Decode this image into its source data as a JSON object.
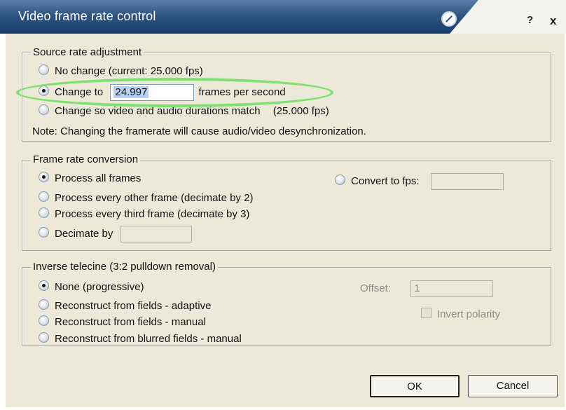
{
  "window": {
    "title": "Video frame rate control",
    "help_label": "?",
    "close_label": "x"
  },
  "source_rate": {
    "title": "Source rate adjustment",
    "option_no_change": "No change (current: 25.000 fps)",
    "option_change_to": "Change to",
    "change_to_value": "24.997",
    "change_to_unit": "frames per second",
    "option_match": "Change so video and audio durations match",
    "match_fps": "(25.000 fps)",
    "note": "Note: Changing the framerate will cause audio/video desynchronization."
  },
  "frame_rate_conversion": {
    "title": "Frame rate conversion",
    "option_all": "Process all frames",
    "option_every_other": "Process every other frame (decimate by 2)",
    "option_every_third": "Process every third frame (decimate by 3)",
    "option_decimate_by": "Decimate by",
    "decimate_value": "",
    "option_convert": "Convert to fps:",
    "convert_value": ""
  },
  "inverse_telecine": {
    "title": "Inverse telecine (3:2 pulldown removal)",
    "option_none": "None (progressive)",
    "option_adaptive": "Reconstruct from fields - adaptive",
    "option_manual": "Reconstruct from fields - manual",
    "option_blurred": "Reconstruct from blurred fields - manual",
    "offset_label": "Offset:",
    "offset_value": "1",
    "invert_polarity_label": "Invert polarity"
  },
  "buttons": {
    "ok": "OK",
    "cancel": "Cancel"
  },
  "colors": {
    "title_bar": "#2f5583",
    "highlight_annotation": "#7ee06e",
    "dialog_background": "#ece9d8"
  }
}
